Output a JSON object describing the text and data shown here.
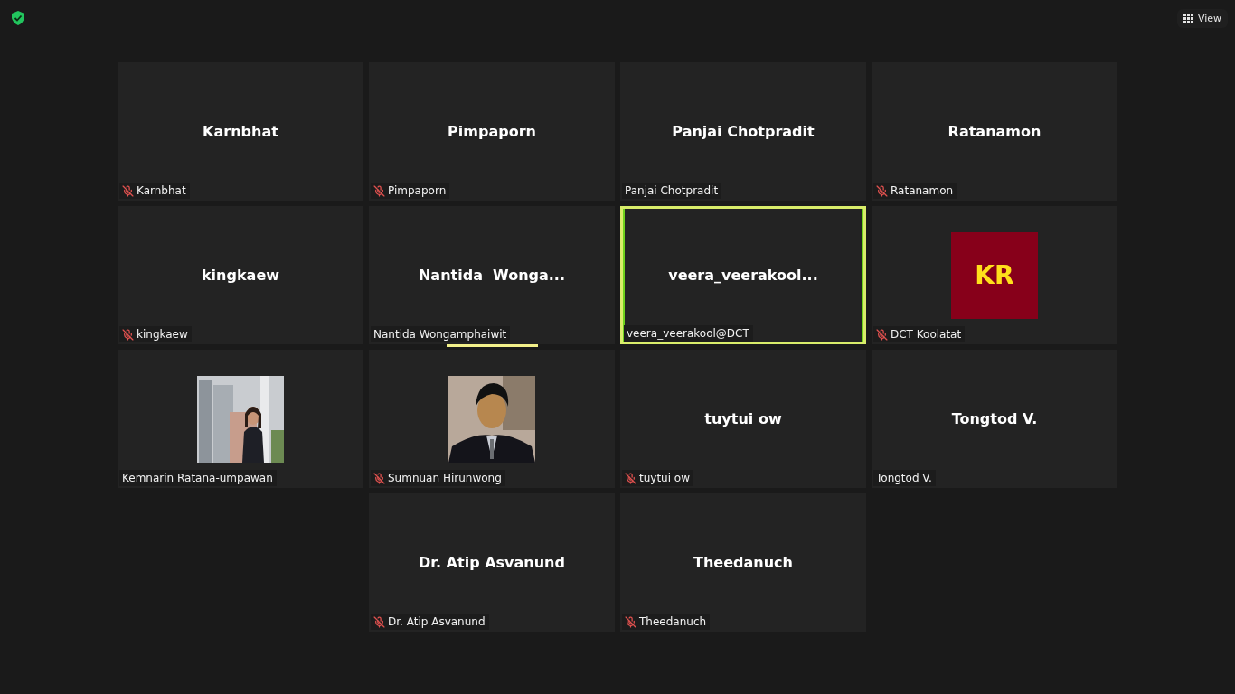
{
  "top_bar": {
    "view_button": "View"
  },
  "rows": [
    [
      {
        "kind": "name",
        "display": "Karnbhat",
        "label": "Karnbhat",
        "muted": true,
        "active": false,
        "audio_bar": false
      },
      {
        "kind": "name",
        "display": "Pimpaporn",
        "label": "Pimpaporn",
        "muted": true,
        "active": false,
        "audio_bar": false
      },
      {
        "kind": "name",
        "display": "Panjai Chotpradit",
        "label": "Panjai Chotpradit",
        "muted": false,
        "active": false,
        "audio_bar": false
      },
      {
        "kind": "name",
        "display": "Ratanamon",
        "label": "Ratanamon",
        "muted": true,
        "active": false,
        "audio_bar": false
      }
    ],
    [
      {
        "kind": "name",
        "display": "kingkaew",
        "label": "kingkaew",
        "muted": true,
        "active": false,
        "audio_bar": false
      },
      {
        "kind": "name",
        "display": "Nantida  Wonga...",
        "label": "Nantida Wongamphaiwit",
        "muted": false,
        "active": false,
        "audio_bar": true
      },
      {
        "kind": "name",
        "display": "veera_veerakool...",
        "label": "veera_veerakool@DCT",
        "muted": false,
        "active": true,
        "audio_bar": false
      },
      {
        "kind": "avatar",
        "display": "KR",
        "label": "DCT Koolatat",
        "muted": true,
        "active": false,
        "audio_bar": false
      }
    ],
    [
      {
        "kind": "picture",
        "label": "Kemnarin Ratana-umpawan",
        "muted": false,
        "active": false,
        "audio_bar": false
      },
      {
        "kind": "picture",
        "label": "Sumnuan Hirunwong",
        "muted": true,
        "active": false,
        "audio_bar": false
      },
      {
        "kind": "name",
        "display": "tuytui ow",
        "label": "tuytui ow",
        "muted": true,
        "active": false,
        "audio_bar": false
      },
      {
        "kind": "name",
        "display": "Tongtod V.",
        "label": "Tongtod V.",
        "muted": false,
        "active": false,
        "audio_bar": false
      }
    ],
    [
      {
        "kind": "name",
        "display": "Dr. Atip Asvanund",
        "label": "Dr. Atip Asvanund",
        "muted": true,
        "active": false,
        "audio_bar": false
      },
      {
        "kind": "name",
        "display": "Theedanuch",
        "label": "Theedanuch",
        "muted": true,
        "active": false,
        "audio_bar": false
      }
    ]
  ]
}
